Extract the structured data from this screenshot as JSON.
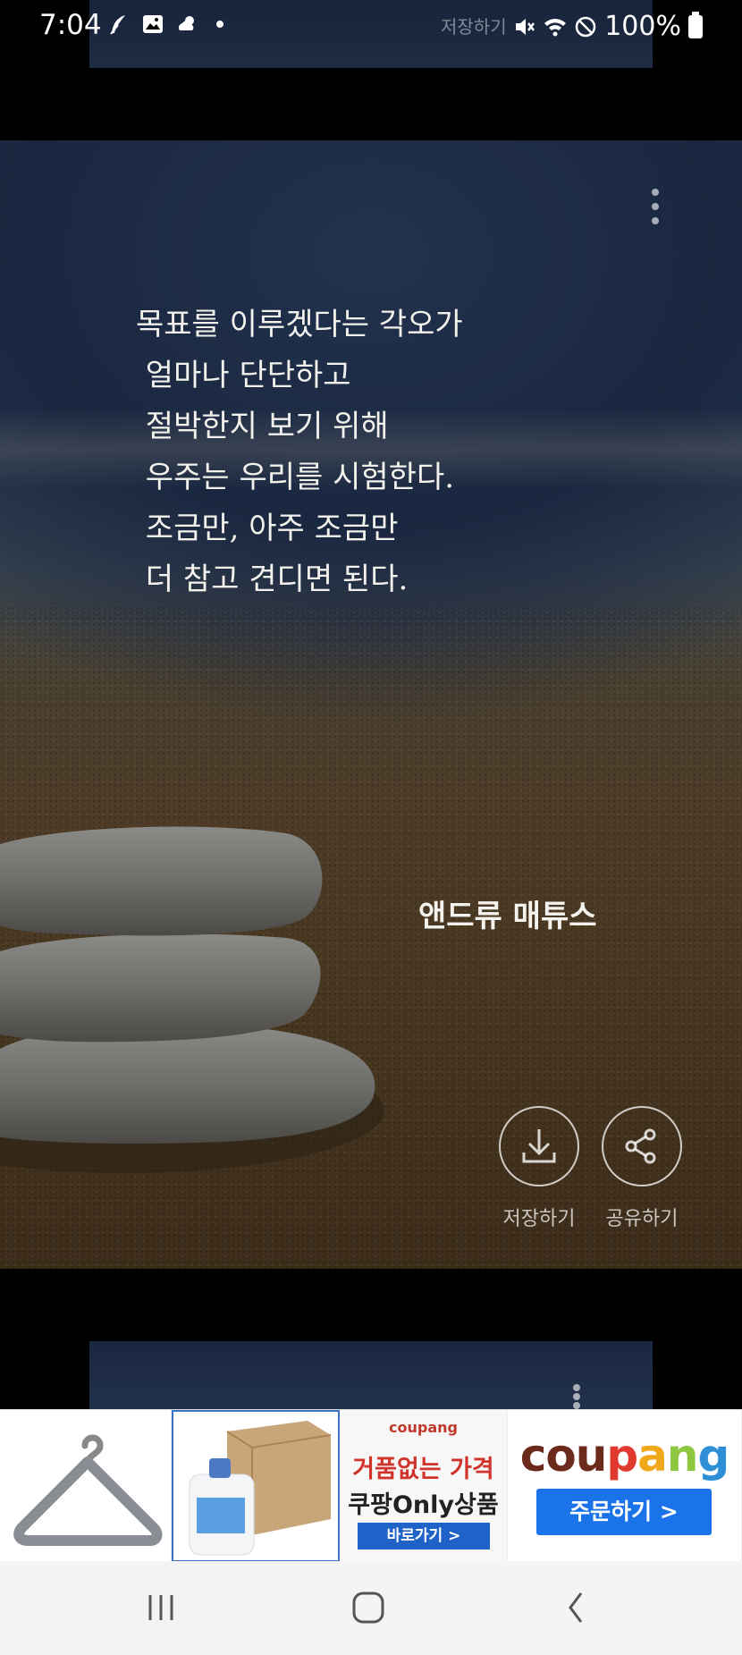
{
  "status_bar": {
    "time": "7:04",
    "battery": "100%",
    "ghost_text": "저장하기",
    "icons": [
      "feather-app-icon",
      "gallery-icon",
      "weather-icon",
      "notification-dot",
      "mute-icon",
      "wifi-icon",
      "do-not-disturb-icon",
      "battery-icon"
    ]
  },
  "card": {
    "quote_lines": [
      "목표를 이루겠다는 각오가",
      " 얼마나 단단하고",
      " 절박한지 보기 위해",
      " 우주는 우리를 시험한다.",
      " 조금만, 아주 조금만",
      " 더 참고 견디면 된다."
    ],
    "author": "앤드류 매튜스",
    "actions": {
      "save_label": "저장하기",
      "share_label": "공유하기"
    }
  },
  "ads": {
    "tile3": {
      "brand": "coupang",
      "line1": "거품없는 가격",
      "line2": "쿠팡Only상품",
      "button": "바로가기 >"
    },
    "tile4": {
      "logo_parts": [
        "cou",
        "p",
        "a",
        "n",
        "g"
      ],
      "button": "주문하기 >"
    }
  },
  "colors": {
    "coupang_blue": "#1a73e8",
    "coupang_red": "#d0342c"
  }
}
